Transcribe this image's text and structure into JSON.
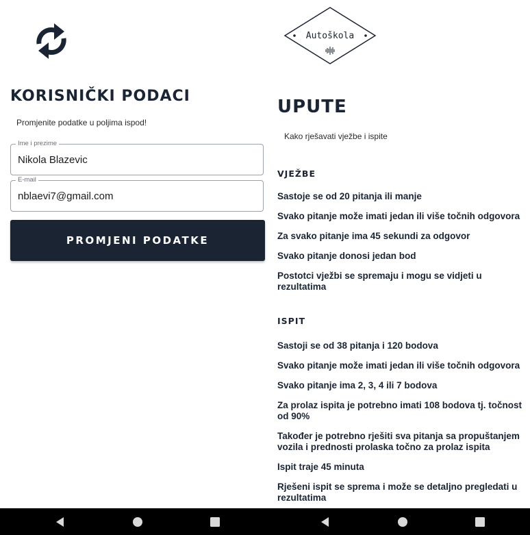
{
  "left": {
    "title": "KORISNIČKI PODACI",
    "subtitle": "Promjenite podatke u poljima ispod!",
    "fields": {
      "name": {
        "label": "Ime i prezime",
        "value": "Nikola Blazevic"
      },
      "email": {
        "label": "E-mail",
        "value": "nblaevi7@gmail.com"
      }
    },
    "save_button": "PROMJENI PODATKE",
    "icon": "refresh-icon"
  },
  "right": {
    "logo": {
      "text": "Autoškola",
      "icon": "soundwave-icon"
    },
    "title": "UPUTE",
    "subtitle": "Kako rješavati vježbe i ispite",
    "sections": [
      {
        "title": "VJEŽBE",
        "items": [
          "Sastoje se od 20 pitanja ili manje",
          "Svako pitanje može imati jedan ili više točnih odgovora",
          "Za svako pitanje ima 45 sekundi za odgovor",
          "Svako pitanje donosi jedan bod",
          "Postotci vježbi se spremaju i mogu se vidjeti u rezultatima"
        ]
      },
      {
        "title": "ISPIT",
        "items": [
          "Sastoji se od 38 pitanja i 120 bodova",
          "Svako pitanje može imati jedan ili više točnih odgovora",
          "Svako pitanje ima 2, 3, 4 ili 7 bodova",
          "Za prolaz ispita je potrebno imati 108 bodova tj. točnost od 90%",
          "Također je potrebno rješiti sva pitanja sa propuštanjem vozila i prednosti prolaska točno za prolaz ispita",
          "Ispit traje 45 minuta",
          "Rješeni ispit se sprema i može se detaljno pregledati u rezultatima"
        ]
      }
    ]
  },
  "navbar": {
    "icons": [
      "back-triangle-icon",
      "home-circle-icon",
      "recents-square-icon"
    ],
    "color": "#000000"
  },
  "colors": {
    "primary": "#1b2433",
    "background": "#ffffff"
  }
}
